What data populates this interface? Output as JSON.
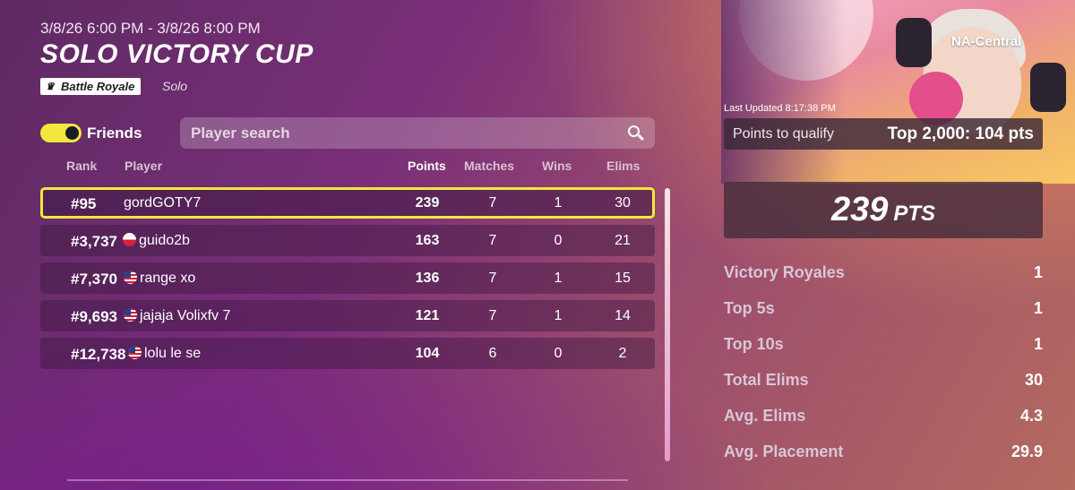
{
  "event": {
    "date_range": "3/8/26 6:00 PM - 3/8/26 8:00 PM",
    "title": "SOLO VICTORY CUP",
    "mode": "Battle Royale",
    "mode_icon": "crown-icon",
    "submode": "Solo"
  },
  "filters": {
    "friends_label": "Friends",
    "friends_toggle_on": true,
    "search_placeholder": "Player search"
  },
  "columns": {
    "rank": "Rank",
    "player": "Player",
    "points": "Points",
    "matches": "Matches",
    "wins": "Wins",
    "elims": "Elims"
  },
  "rows": [
    {
      "rank": "#95",
      "player": "gordGOTY7",
      "flag": "",
      "points": "239",
      "matches": "7",
      "wins": "1",
      "elims": "30",
      "highlight": true
    },
    {
      "rank": "#3,737",
      "player": "guido2b",
      "flag": "pl",
      "points": "163",
      "matches": "7",
      "wins": "0",
      "elims": "21"
    },
    {
      "rank": "#7,370",
      "player": "range xo",
      "flag": "us",
      "points": "136",
      "matches": "7",
      "wins": "1",
      "elims": "15"
    },
    {
      "rank": "#9,693",
      "player": "jajaja Volixfv 7",
      "flag": "us",
      "points": "121",
      "matches": "7",
      "wins": "1",
      "elims": "14"
    },
    {
      "rank": "#12,738",
      "player": "lolu le se",
      "flag": "us",
      "points": "104",
      "matches": "6",
      "wins": "0",
      "elims": "2"
    }
  ],
  "side": {
    "region": "NA-Central",
    "last_updated": "Last Updated 8:17:38 PM",
    "qualify_label": "Points to qualify",
    "qualify_value": "Top 2,000: 104 pts",
    "points_value": "239",
    "points_unit": "PTS",
    "stats": [
      {
        "label": "Victory Royales",
        "value": "1"
      },
      {
        "label": "Top 5s",
        "value": "1"
      },
      {
        "label": "Top 10s",
        "value": "1"
      },
      {
        "label": "Total Elims",
        "value": "30"
      },
      {
        "label": "Avg. Elims",
        "value": "4.3"
      },
      {
        "label": "Avg. Placement",
        "value": "29.9"
      }
    ]
  },
  "colors": {
    "accent_yellow": "#f2e73b",
    "background": "#7a2f78"
  }
}
